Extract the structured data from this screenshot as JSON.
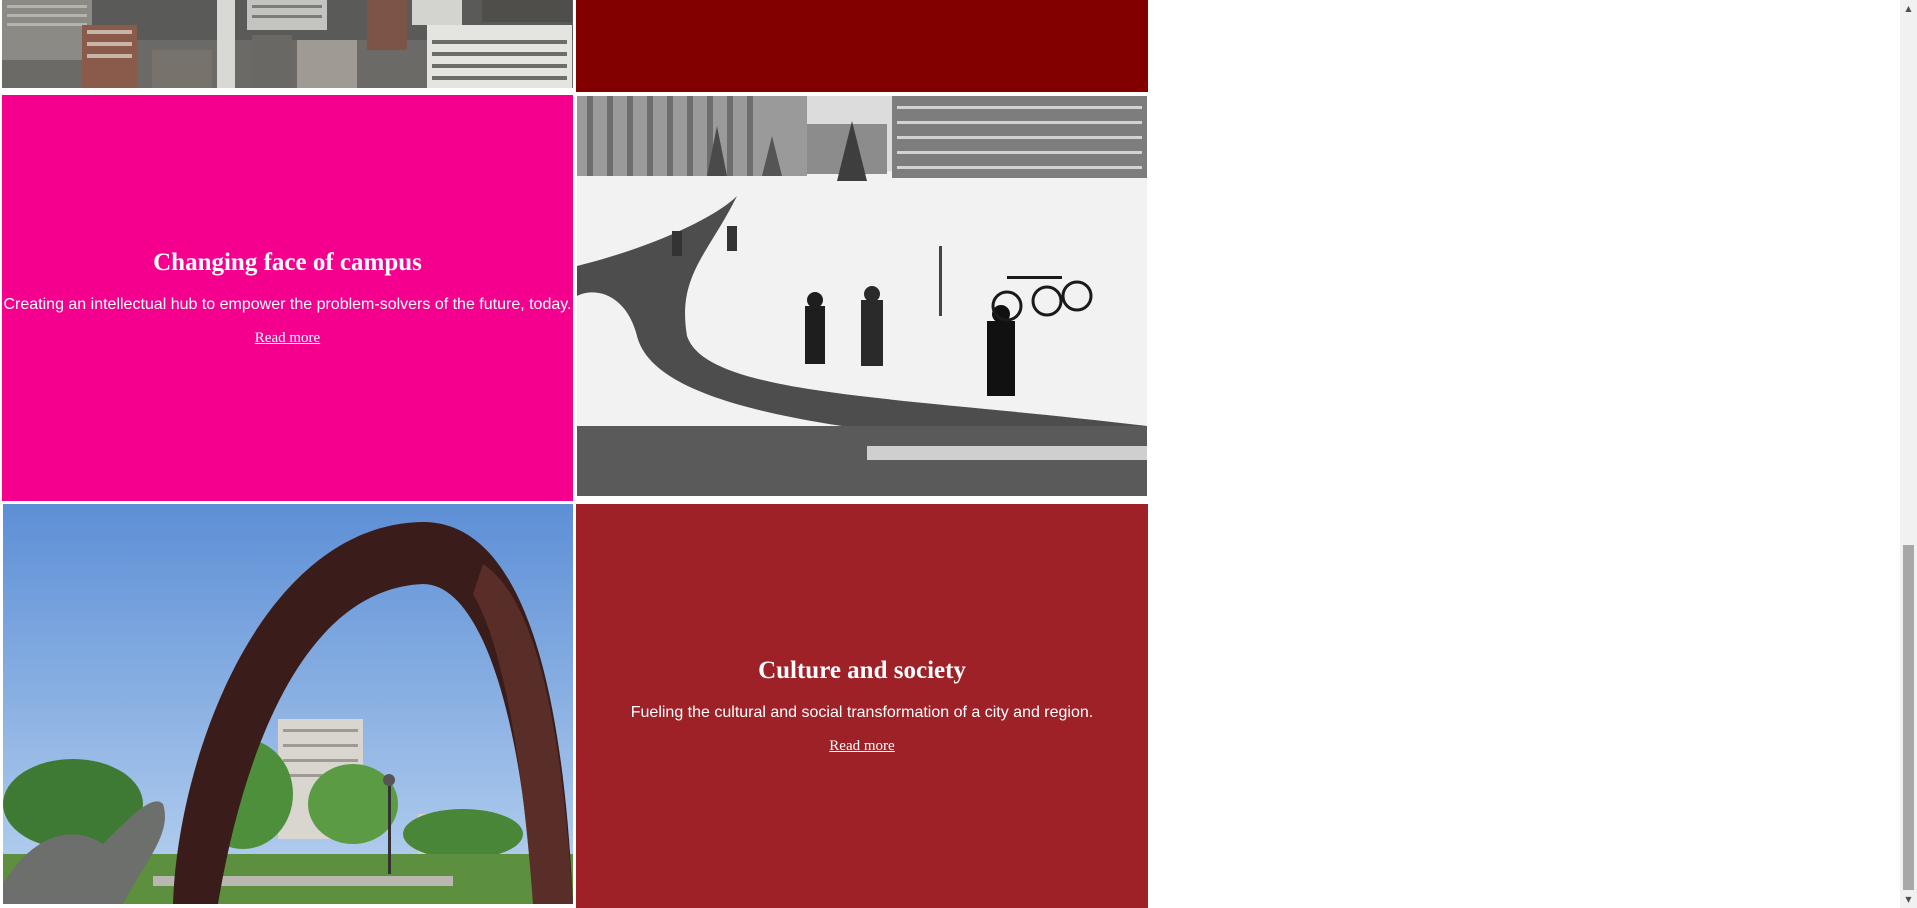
{
  "tiles": {
    "campus": {
      "title": "Changing face of campus",
      "description": "Creating an intellectual hub to empower the problem-solvers of the future, today.",
      "link": "Read more",
      "color": "#f5008e"
    },
    "culture": {
      "title": "Culture and society",
      "description": "Fueling the cultural and social transformation of a city and region.",
      "link": "Read more",
      "color": "#9e2128"
    },
    "top_right": {
      "color": "#830000"
    }
  },
  "images": {
    "city_aerial": "city-aerial-photo",
    "winter_campus": "winter-campus-photo",
    "arch_sculpture": "arch-sculpture-photo"
  },
  "scrollbar": {
    "up_icon": "scroll-up-arrow-icon",
    "down_icon": "scroll-down-arrow-icon"
  }
}
